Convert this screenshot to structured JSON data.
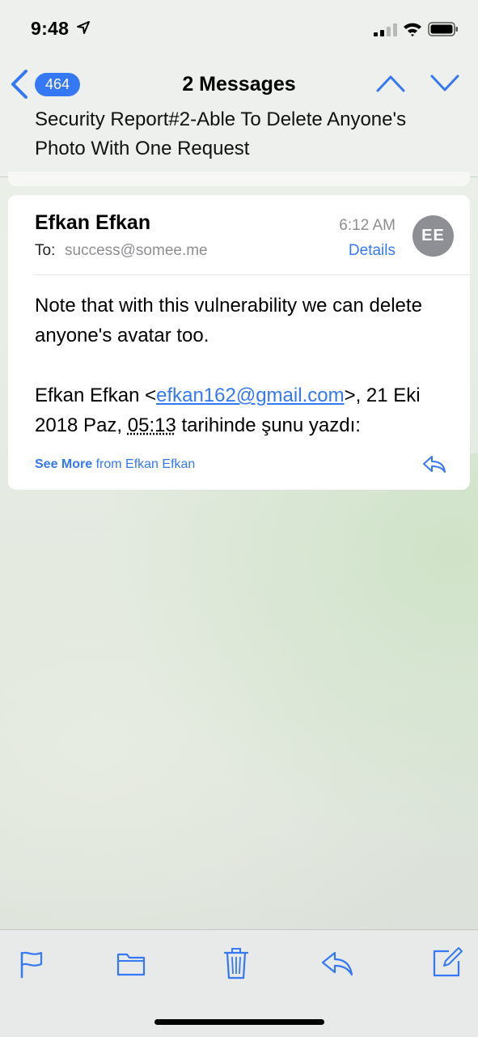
{
  "status_bar": {
    "time": "9:48"
  },
  "nav": {
    "unread_count": "464",
    "title": "2 Messages",
    "subject": "Security Report#2-Able To Delete Anyone's Photo With One Request"
  },
  "message": {
    "sender": "Efkan Efkan",
    "to_label": "To:",
    "to_value": "success@somee.me",
    "time": "6:12 AM",
    "details_label": "Details",
    "avatar_initials": "EE",
    "body_line1": "Note that with this vulnerability we can delete anyone's avatar too.",
    "quote_prefix": "Efkan Efkan <",
    "quote_email": "efkan162@gmail.com",
    "quote_mid": ">, 21 Eki 2018 Paz, ",
    "quote_time": "05:13",
    "quote_suffix": " tarihinde şunu yazdı:",
    "see_more": "See More",
    "see_more_from": " from Efkan Efkan"
  },
  "colors": {
    "accent": "#3478f6",
    "secondary_text": "#8e8e93",
    "avatar": "#8e8e95"
  },
  "toolbar": {
    "icons": [
      "flag-icon",
      "folder-icon",
      "trash-icon",
      "reply-icon",
      "compose-icon"
    ]
  }
}
